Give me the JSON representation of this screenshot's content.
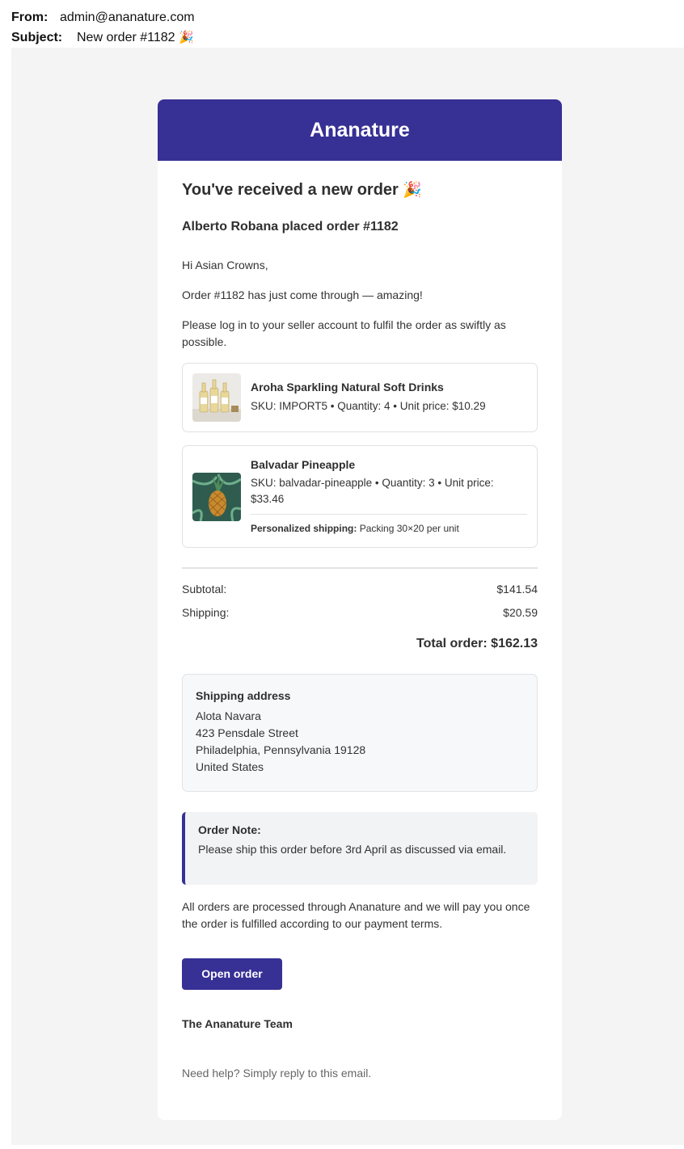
{
  "email": {
    "from_label": "From:",
    "from_value": "admin@ananature.com",
    "subject_label": "Subject:",
    "subject_value": "New order #1182",
    "subject_emoji": "🎉"
  },
  "banner": {
    "brand": "Ananature",
    "color": "#373095"
  },
  "heading": {
    "title": "You've received a new order",
    "emoji": "🎉",
    "subtitle": "Alberto Robana placed order #1182"
  },
  "message": {
    "greeting": "Hi Asian Crowns,",
    "line1": "Order #1182 has just come through — amazing!",
    "line2": "Please log in to your seller account to fulfil the order as swiftly as possible."
  },
  "items": [
    {
      "name": "Aroha Sparkling Natural Soft Drinks",
      "meta": "SKU: IMPORT5 • Quantity: 4 • Unit price: $10.29",
      "thumb_icon": "bottles-image"
    },
    {
      "name": "Balvadar Pineapple",
      "meta": "SKU: balvadar-pineapple • Quantity: 3 • Unit price: $33.46",
      "shipping_label": "Personalized shipping:",
      "shipping_value": "Packing 30×20 per unit",
      "thumb_icon": "pineapple-image"
    }
  ],
  "totals": {
    "subtotal_label": "Subtotal:",
    "subtotal_value": "$141.54",
    "shipping_label": "Shipping:",
    "shipping_value": "$20.59",
    "total_text": "Total order: $162.13"
  },
  "address": {
    "title": "Shipping address",
    "lines": [
      "Alota Navara",
      "423 Pensdale Street",
      "Philadelphia, Pennsylvania 19128",
      "United States"
    ]
  },
  "note": {
    "title": "Order Note:",
    "text": "Please ship this order before 3rd April as discussed via email."
  },
  "footer": {
    "payment_text": "All orders are processed through Ananature and we will pay you once the order is fulfilled according to our payment terms.",
    "button_label": "Open order",
    "signature": "The Ananature Team",
    "help": "Need help? Simply reply to this email."
  }
}
